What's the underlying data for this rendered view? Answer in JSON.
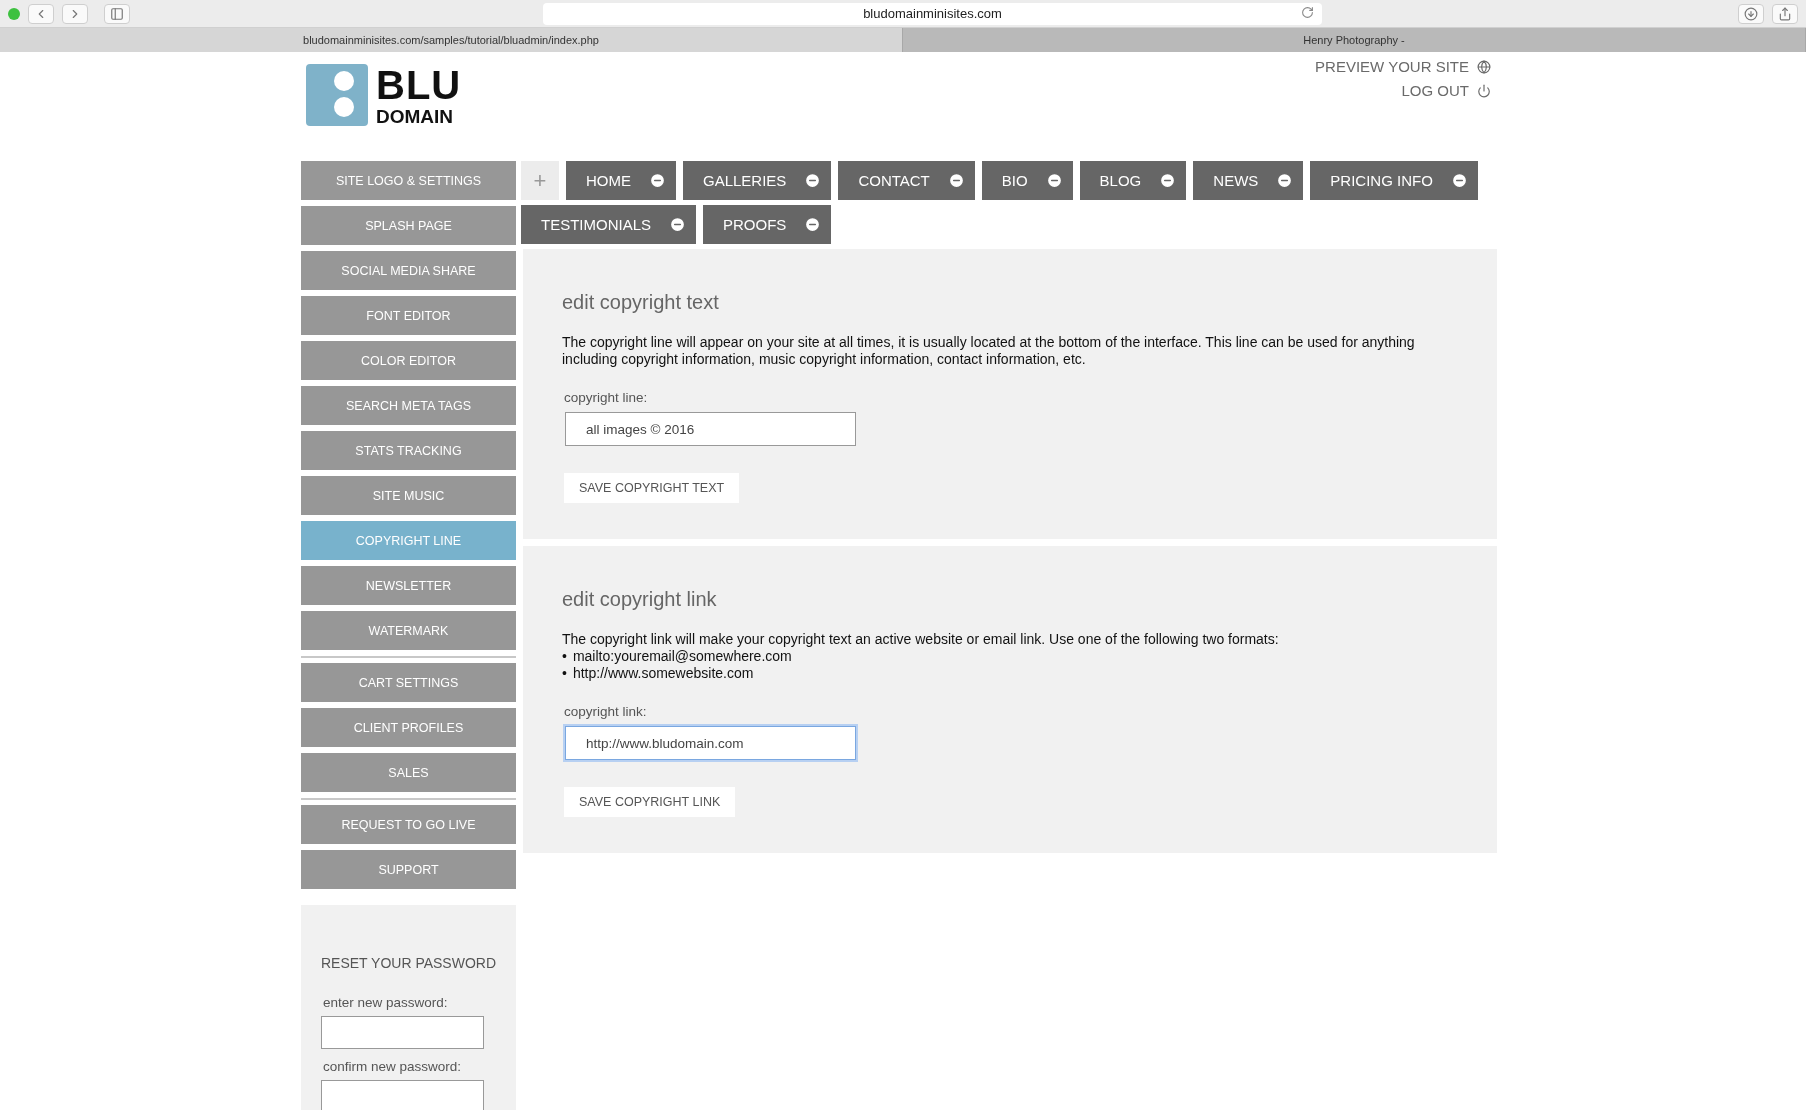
{
  "browser": {
    "address": "bludomainminisites.com",
    "tabs": [
      {
        "label": "bludomainminisites.com/samples/tutorial/bluadmin/index.php",
        "selected": true
      },
      {
        "label": "Henry Photography -",
        "selected": false
      }
    ]
  },
  "header": {
    "logo": {
      "line1": "BLU",
      "line2": "DOMAIN"
    },
    "links": [
      {
        "label": "PREVIEW YOUR SITE",
        "kind": "globe"
      },
      {
        "label": "LOG OUT",
        "kind": "power"
      }
    ]
  },
  "sidebar": {
    "groups": [
      [
        {
          "label": "SITE LOGO & SETTINGS",
          "selected": false
        },
        {
          "label": "SPLASH PAGE",
          "selected": false
        },
        {
          "label": "SOCIAL MEDIA SHARE",
          "selected": false
        },
        {
          "label": "FONT EDITOR",
          "selected": false
        },
        {
          "label": "COLOR EDITOR",
          "selected": false
        },
        {
          "label": "SEARCH META TAGS",
          "selected": false
        },
        {
          "label": "STATS TRACKING",
          "selected": false
        },
        {
          "label": "SITE MUSIC",
          "selected": false
        },
        {
          "label": "COPYRIGHT LINE",
          "selected": true
        },
        {
          "label": "NEWSLETTER",
          "selected": false
        },
        {
          "label": "WATERMARK",
          "selected": false
        }
      ],
      [
        {
          "label": "CART SETTINGS",
          "selected": false
        },
        {
          "label": "CLIENT PROFILES",
          "selected": false
        },
        {
          "label": "SALES",
          "selected": false
        }
      ],
      [
        {
          "label": "REQUEST TO GO LIVE",
          "selected": false
        },
        {
          "label": "SUPPORT",
          "selected": false
        }
      ]
    ],
    "reset_password": {
      "title": "RESET YOUR PASSWORD",
      "fields": [
        {
          "label": "enter new password:"
        },
        {
          "label": "confirm new password:"
        }
      ]
    }
  },
  "nav": {
    "add": "+",
    "pages": [
      {
        "label": "HOME"
      },
      {
        "label": "GALLERIES"
      },
      {
        "label": "CONTACT"
      },
      {
        "label": "BIO"
      },
      {
        "label": "BLOG"
      },
      {
        "label": "NEWS"
      },
      {
        "label": "PRICING INFO"
      },
      {
        "label": "TESTIMONIALS"
      },
      {
        "label": "PROOFS"
      }
    ]
  },
  "sections": [
    {
      "title": "edit copyright text",
      "description": "The copyright line will appear on your site at all times, it is usually located at the bottom of the interface. This line can be used for anything including copyright information, music copyright information, contact information, etc.",
      "field_label": "copyright line:",
      "value": "all images © 2016",
      "focused": false,
      "button": "SAVE COPYRIGHT TEXT"
    },
    {
      "title": "edit copyright link",
      "description": "The copyright link will make your copyright text an active website or email link. Use one of the following two formats:",
      "bullets": [
        {
          "marker": "•",
          "text": "mailto:youremail@somewhere.com"
        },
        {
          "marker": "•",
          "text": "http://www.somewebsite.com"
        }
      ],
      "field_label": "copyright link:",
      "value": "http://www.bludomain.com",
      "focused": true,
      "button": "SAVE COPYRIGHT LINK"
    }
  ]
}
